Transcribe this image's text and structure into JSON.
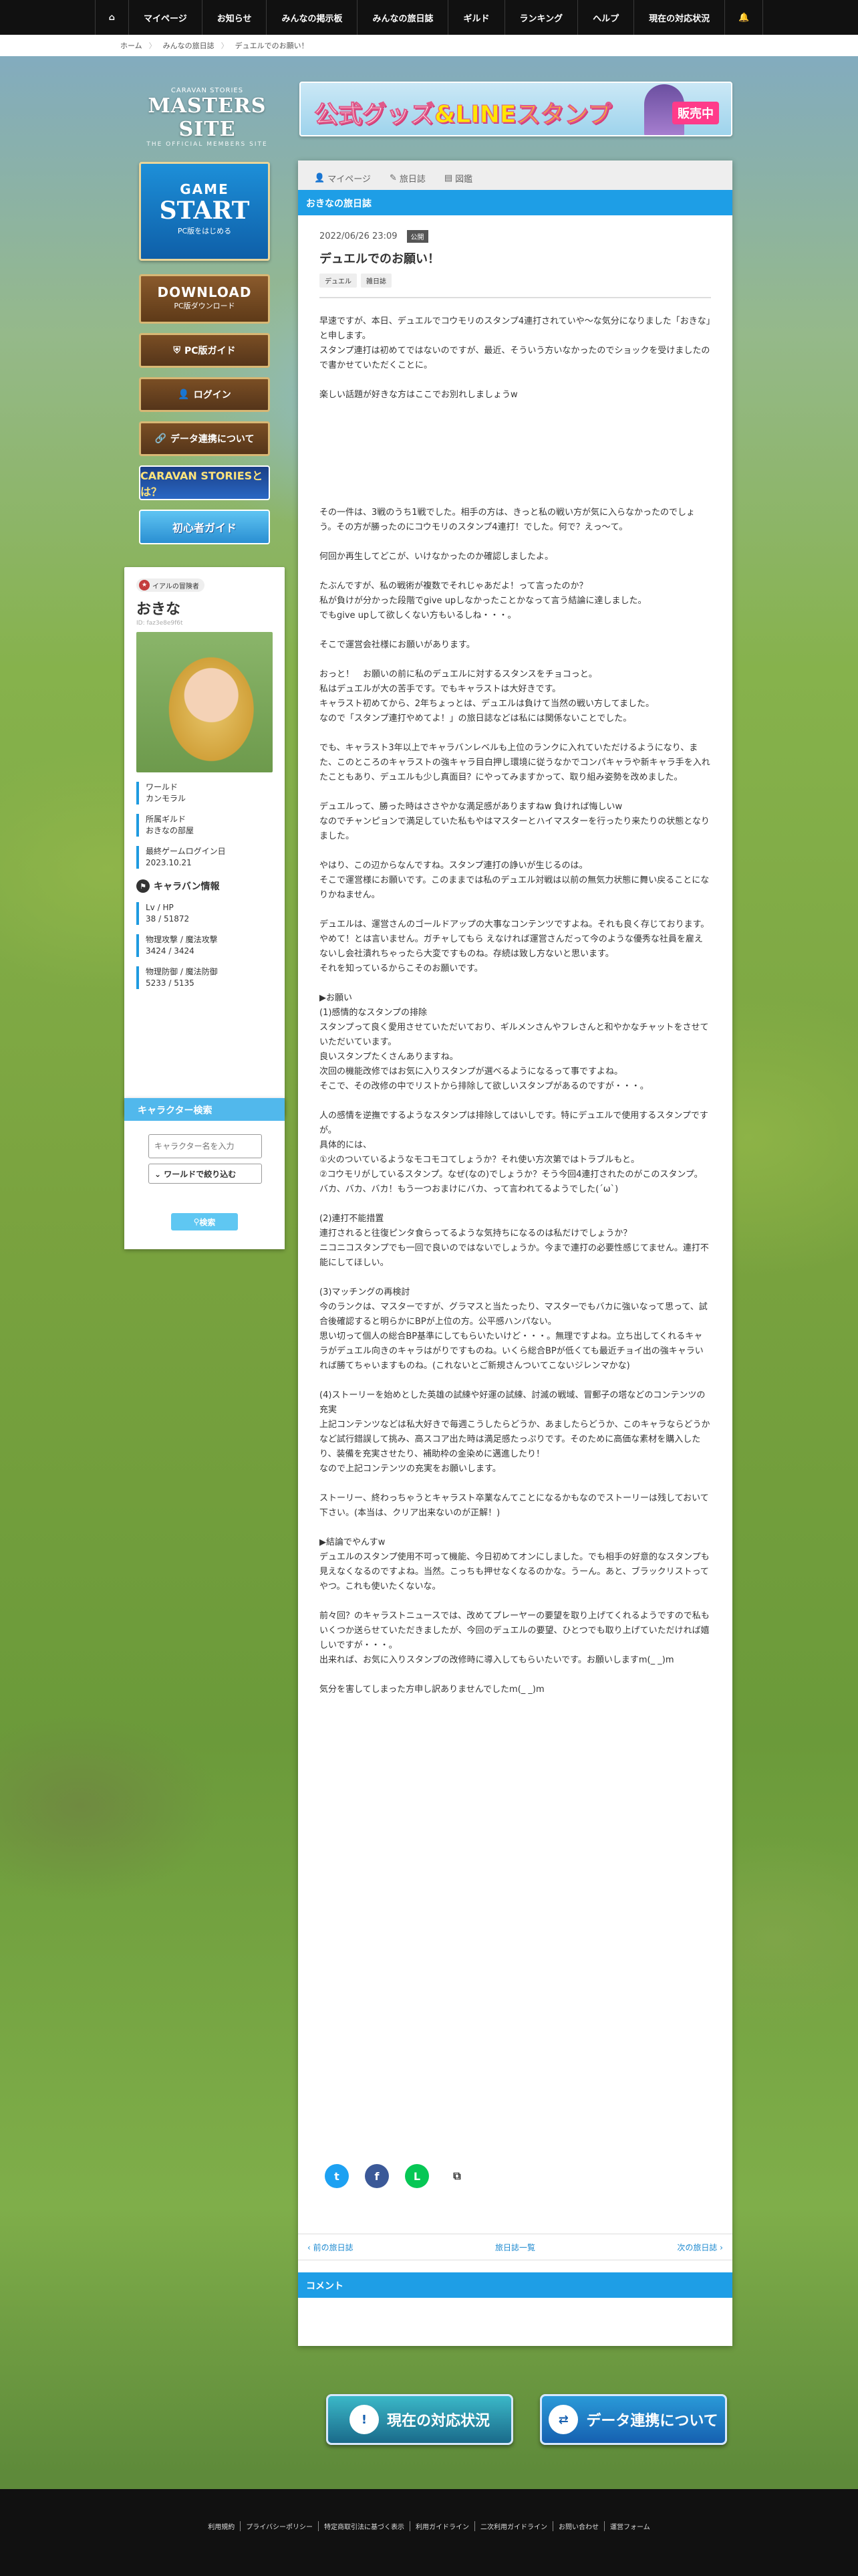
{
  "topnav": {
    "items": [
      "マイページ",
      "お知らせ",
      "みんなの掲示板",
      "みんなの旅日誌",
      "ギルド",
      "ランキング",
      "ヘルプ",
      "現在の対応状況"
    ]
  },
  "breadcrumb": [
    "ホーム",
    "みんなの旅日誌",
    "デュエルでのお願い！"
  ],
  "header": {
    "logo_small": "CARAVAN STORIES",
    "logo_big": "MASTERS SITE",
    "logo_sub": "THE OFFICIAL MEMBERS SITE",
    "banner_text": "公式グッズ",
    "banner_text2": "&LINEスタンプ",
    "banner_badge": "販売中"
  },
  "sidebar": {
    "game_start_1": "GAME",
    "game_start_2": "START",
    "game_start_3": "PC版をはじめる",
    "download_1": "DOWNLOAD",
    "download_2": "PC版ダウンロード",
    "pc_guide": "PC版ガイド",
    "login": "ログイン",
    "data_link": "データ連携について",
    "caravan_what": "CARAVAN STORIESとは？",
    "beginner_guide": "初心者ガイド"
  },
  "profile": {
    "guild_tag": "イアルの冒険者",
    "name": "おきな",
    "uid": "ID: faz3e8e9f6t",
    "world_label": "ワールド",
    "world_value": "カンモラル",
    "guild_label": "所属ギルド",
    "guild_value": "おきなの部屋",
    "login_label": "最終ゲームログイン日",
    "login_value": "2023.10.21",
    "caravan_title": "キャラバン情報",
    "lv_label": "Lv / HP",
    "lv_value": "38 / 51872",
    "atk_label": "物理攻撃 / 魔法攻撃",
    "atk_value": "3424 / 3424",
    "def_label": "物理防御 / 魔法防御",
    "def_value": "5233 / 5135"
  },
  "search": {
    "title": "キャラクター検索",
    "placeholder": "キャラクター名を入力",
    "filter": "ワールドで絞り込む",
    "button": "検索"
  },
  "main": {
    "tabs": [
      "マイページ",
      "旅日誌",
      "図鑑"
    ],
    "section_title": "おきなの旅日誌",
    "date": "2022/06/26 23:09",
    "status": "公開",
    "title": "デュエルでのお願い！",
    "tags": [
      "デュエル",
      "雑日誌"
    ],
    "paragraphs": [
      "早速ですが、本日、デュエルでコウモリのスタンプ4連打されていや～な気分になりました「おきな」と申します。\nスタンプ連打は初めてではないのですが、最近、そういう方いなかったのでショックを受けましたので書かせていただくことに。",
      "楽しい話題が好きな方はここでお別れしましょうw",
      "\n\n\n",
      "その一件は、3戦のうち1戦でした。相手の方は、きっと私の戦い方が気に入らなかったのでしょう。その方が勝ったのにコウモリのスタンプ4連打！でした。何で？えっ～て。",
      "何回か再生してどこが、いけなかったのか確認しましたよ。",
      "たぶんですが、私の戦術が複数でそれじゃあだよ！って言ったのか？\n私が負けが分かった段階でgive upしなかったことかなって言う結論に達しました。\nでもgive upして欲しくない方もいるしね・・・。",
      "そこで運営会社様にお願いがあります。",
      "おっと！　お願いの前に私のデュエルに対するスタンスをチョコっと。\n私はデュエルが大の苦手です。でもキャラストは大好きです。\nキャラスト初めてから、2年ちょっとは、デュエルは負けて当然の戦い方してました。\nなので「スタンプ連打やめてよ！」の旅日誌などは私には関係ないことでした。",
      "でも、キャラスト3年以上でキャラバンレベルも上位のランクに入れていただけるようになり、また、このところのキャラストの強キャラ目白押し環境に従うなかでコンパキャラや新キャラ手を入れたこともあり、デュエルも少し真面目？にやってみますかって、取り組み姿勢を改めました。",
      "デュエルって、勝った時はささやかな満足感がありますねw 負ければ悔しいw\nなのでチャンピョンで満足していた私もやはマスターとハイマスターを行ったり来たりの状態となりました。",
      "やはり、この辺からなんですね。スタンプ連打の諍いが生じるのは。\nそこで運営様にお願いです。このままでは私のデュエル対戦は以前の無気力状態に舞い戻ることになりかねません。",
      "デュエルは、運営さんのゴールドアップの大事なコンテンツですよね。それも良く存じております。やめて！とは言いません。ガチャしてもら えなければ運営さんだって今のような優秀な社員を雇えないし会社潰れちゃったら大変ですものね。存続は致し方ないと思います。\nそれを知っているからこそのお願いです。",
      "▶お願い\n(1)感情的なスタンプの排除\nスタンプって良く愛用させていただいており、ギルメンさんやフレさんと和やかなチャットをさせていただいています。\n良いスタンプたくさんありますね。\n次回の機能改修ではお気に入りスタンプが選べるようになるって事ですよね。\nそこで、その改修の中でリストから排除して欲しいスタンプがあるのですが・・・。",
      "人の感情を逆撫でするようなスタンプは排除してはいしです。特にデュエルで使用するスタンプですが。\n具体的には、\n①火のついているようなモコモコてしょうか？それ使い方次第ではトラブルもと。\n②コウモリがしているスタンプ。なぜ(なの)でしょうか？そう今回4連打されたのがこのスタンプ。バカ、バカ、バカ！もう一つおまけにバカ、って言われてるようでした(´ω`)",
      "(2)連打不能措置\n連打されると往復ピンタ食らってるような気持ちになるのは私だけでしょうか？\nニコニコスタンプでも一回で良いのではないでしょうか。今まで連打の必要性感じてません。連打不能にしてほしい。",
      "(3)マッチングの再検討\n今のランクは、マスターですが、グラマスと当たったり、マスターでもバカに強いなって思って、試合後確認すると明らかにBPが上位の方。公平感ハンパない。\n思い切って個人の総合BP基準にしてもらいたいけど・・・。無理ですよね。立ち出してくれるキャラがデュエル向きのキャラはがりですものね。いくら総合BPが低くても最近チョイ出の強キャラいれば勝てちゃいますものね。(これないとご新規さんついてこないジレンマかな)",
      "(4)ストーリーを始めとした英雄の試練や好運の試練、討滅の戦域、冒郵子の塔などのコンテンツの充実\n上記コンテンツなどは私大好きで毎週こうしたらどうか、あましたらどうか、このキャラならどうかなど試行錯誤して挑み、高スコア出た時は満足感たっぷりです。そのために高価な素材を購入したり、装備を充実させたり、補助枠の金染めに邁進したり！\nなので上記コンテンツの充実をお願いします。",
      "ストーリー、終わっちゃうとキャラスト卒業なんてことになるかもなのでストーリーは残しておいて下さい。(本当は、クリア出来ないのが正解！)",
      "▶結論でやんすw\nデュエルのスタンプ使用不可って機能、今日初めてオンにしました。でも相手の好意的なスタンプも見えなくなるのですよね。当然。こっちも押せなくなるのかな。うーん。あと、ブラックリストってやつ。これも使いたくないな。",
      "前々回？のキャラストニュースでは、改めてプレーヤーの要望を取り上げてくれるようですので私もいくつか送らせていただきましたが、今回のデュエルの要望、ひとつでも取り上げていただければ嬉しいですが・・・。\n出来れば、お気に入りスタンプの改修時に導入してもらいたいです。お願いしますm(_ _)m",
      "気分を害してしまった方申し訳ありませんでしたm(_ _)m"
    ],
    "pager_prev": "前の旅日誌",
    "pager_list": "旅日誌一覧",
    "pager_next": "次の旅日誌",
    "comment_title": "コメント"
  },
  "bottom": {
    "status_button": "現在の対応状況",
    "data_button": "データ連携について"
  },
  "footer": {
    "links": [
      "利用規約",
      "プライバシーポリシー",
      "特定商取引法に基づく表示",
      "利用ガイドライン",
      "二次利用ガイドライン",
      "お問い合わせ",
      "運営フォーム"
    ]
  },
  "colors": {
    "accent": "#1e9ee6",
    "nav_bg": "#111111"
  }
}
